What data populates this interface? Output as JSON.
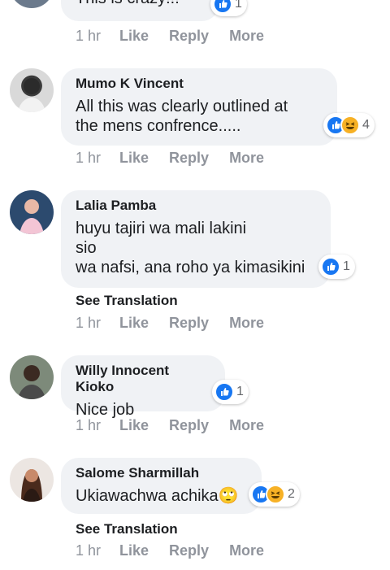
{
  "comments": [
    {
      "text": "This is crazy!!!",
      "reaction_count": "1",
      "actions": {
        "time": "1 hr",
        "like": "Like",
        "reply": "Reply",
        "more": "More"
      }
    },
    {
      "name": "Mumo K Vincent",
      "text": "All this was clearly outlined at\nthe mens confrence.....",
      "reaction_count": "4",
      "actions": {
        "time": "1 hr",
        "like": "Like",
        "reply": "Reply",
        "more": "More"
      }
    },
    {
      "name": "Lalia Pamba",
      "text": "huyu tajiri wa mali lakini\nsio\nwa nafsi, ana roho ya kimasikini",
      "reaction_count": "1",
      "see_translation": "See Translation",
      "actions": {
        "time": "1 hr",
        "like": "Like",
        "reply": "Reply",
        "more": "More"
      }
    },
    {
      "name": "Willy Innocent Kioko",
      "text": "Nice job",
      "reaction_count": "1",
      "actions": {
        "time": "1 hr",
        "like": "Like",
        "reply": "Reply",
        "more": "More"
      }
    },
    {
      "name": "Salome Sharmillah",
      "text": "Ukiawachwa achika",
      "emoji": "🙄",
      "reaction_count": "2",
      "see_translation": "See Translation",
      "actions": {
        "time": "1 hr",
        "like": "Like",
        "reply": "Reply",
        "more": "More"
      }
    }
  ],
  "colors": {
    "like": "#1877f2",
    "haha": "#f7b125",
    "bubble": "#f0f2f5",
    "meta": "#90949c"
  }
}
